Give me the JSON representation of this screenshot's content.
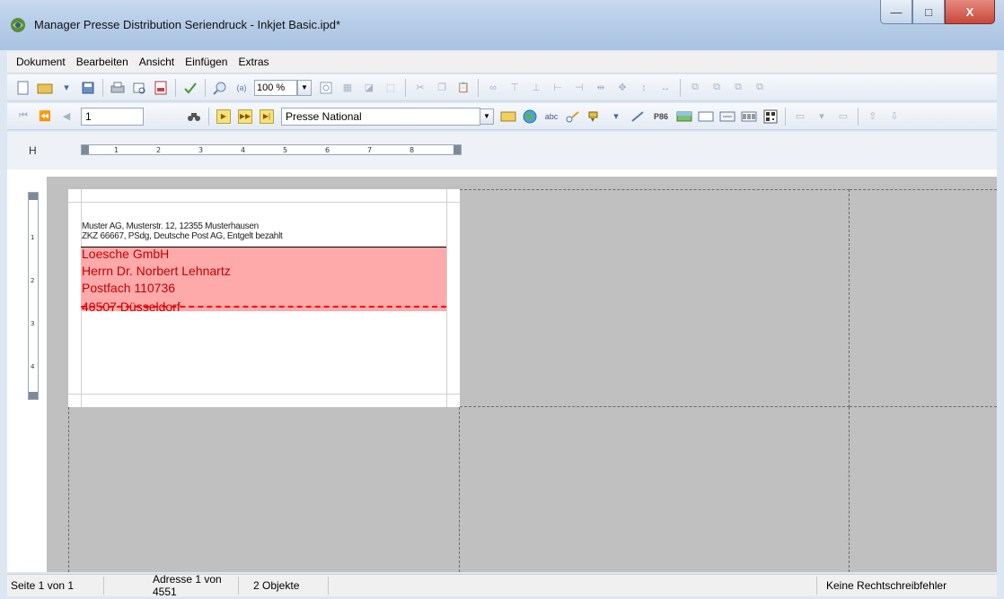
{
  "window": {
    "title": "Manager Presse Distribution Seriendruck - Inkjet Basic.ipd*",
    "minimize_symbol": "—",
    "maximize_symbol": "□",
    "close_symbol": "X"
  },
  "menu": [
    "Dokument",
    "Bearbeiten",
    "Ansicht",
    "Einfügen",
    "Extras"
  ],
  "toolbar1": {
    "zoom_value": "100 %"
  },
  "toolbar2": {
    "record_number": "1",
    "list_value": "Presse National",
    "special_label": "P86",
    "abc_label": "abc"
  },
  "ruler": {
    "h_label": "H",
    "h_ticks": [
      "1",
      "2",
      "3",
      "4",
      "5",
      "6",
      "7",
      "8"
    ],
    "v_ticks": [
      "1",
      "2",
      "3",
      "4"
    ]
  },
  "label_content": {
    "sender_line1": "Muster AG, Musterstr. 12, 12355 Musterhausen",
    "sender_line2": "ZKZ 66667, PSdg, Deutsche Post AG, Entgelt bezahlt",
    "address": [
      "Loesche GmbH",
      "Herrn Dr. Norbert Lehnartz",
      "Postfach 110736",
      "40507 Düsseldorf"
    ]
  },
  "status": {
    "page": "Seite 1 von 1",
    "address": "Adresse 1 von 4551",
    "objects": "2 Objekte",
    "spelling": "Keine Rechtschreibfehler"
  },
  "colors": {
    "address_highlight": "#ffaaaa",
    "address_text": "#c00000",
    "canvas": "#c0c0c0"
  }
}
